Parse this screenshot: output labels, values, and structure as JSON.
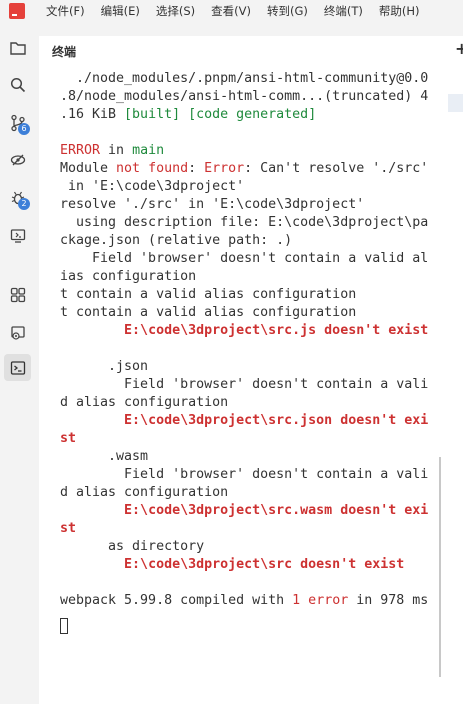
{
  "menu": {
    "items": [
      "文件(F)",
      "编辑(E)",
      "选择(S)",
      "查看(V)",
      "转到(G)",
      "终端(T)",
      "帮助(H)"
    ]
  },
  "activity": {
    "source_control_badge": "6",
    "debug_badge": "2"
  },
  "panel": {
    "title": "终端",
    "add_label": "+"
  },
  "terminal": {
    "lines": [
      [
        {
          "t": "  ./node_modules/.pnpm/ansi-html-community@0.0"
        }
      ],
      [
        {
          "t": ".8/node_modules/ansi-html-comm...(truncated) 4"
        }
      ],
      [
        {
          "t": ".16 KiB "
        },
        {
          "t": "[built]",
          "c": "g"
        },
        {
          "t": " "
        },
        {
          "t": "[code generated]",
          "c": "g"
        }
      ],
      [
        {
          "t": ""
        }
      ],
      [
        {
          "t": "ERROR",
          "c": "r"
        },
        {
          "t": " in "
        },
        {
          "t": "main",
          "c": "g"
        }
      ],
      [
        {
          "t": "Module "
        },
        {
          "t": "not found",
          "c": "r"
        },
        {
          "t": ": "
        },
        {
          "t": "Error",
          "c": "r"
        },
        {
          "t": ": Can't resolve './src'"
        }
      ],
      [
        {
          "t": " in 'E:\\code\\3dproject'"
        }
      ],
      [
        {
          "t": "resolve './src' in 'E:\\code\\3dproject'"
        }
      ],
      [
        {
          "t": "  using description file: E:\\code\\3dproject\\pa"
        }
      ],
      [
        {
          "t": "ckage.json (relative path: .)"
        }
      ],
      [
        {
          "t": "    Field 'browser' doesn't contain a valid al"
        }
      ],
      [
        {
          "t": "ias configuration"
        }
      ],
      [
        {
          "t": "t contain a valid alias configuration"
        }
      ],
      [
        {
          "t": "t contain a valid alias configuration"
        }
      ],
      [
        {
          "t": "        "
        },
        {
          "t": "E:\\code\\3dproject\\src.js doesn't exist",
          "c": "rb"
        }
      ],
      [
        {
          "t": ""
        }
      ],
      [
        {
          "t": "      .json"
        }
      ],
      [
        {
          "t": "        Field 'browser' doesn't contain a vali"
        }
      ],
      [
        {
          "t": "d alias configuration"
        }
      ],
      [
        {
          "t": "        "
        },
        {
          "t": "E:\\code\\3dproject\\src.json doesn't exi",
          "c": "rb"
        }
      ],
      [
        {
          "t": "st",
          "c": "rb"
        }
      ],
      [
        {
          "t": "      .wasm"
        }
      ],
      [
        {
          "t": "        Field 'browser' doesn't contain a vali"
        }
      ],
      [
        {
          "t": "d alias configuration"
        }
      ],
      [
        {
          "t": "        "
        },
        {
          "t": "E:\\code\\3dproject\\src.wasm doesn't exi",
          "c": "rb"
        }
      ],
      [
        {
          "t": "st",
          "c": "rb"
        }
      ],
      [
        {
          "t": "      as directory"
        }
      ],
      [
        {
          "t": "        "
        },
        {
          "t": "E:\\code\\3dproject\\src doesn't exist",
          "c": "rb"
        }
      ],
      [
        {
          "t": ""
        }
      ],
      [
        {
          "t": "webpack 5.99.8 compiled with "
        },
        {
          "t": "1 error",
          "c": "r"
        },
        {
          "t": " in 978 ms"
        }
      ]
    ]
  }
}
